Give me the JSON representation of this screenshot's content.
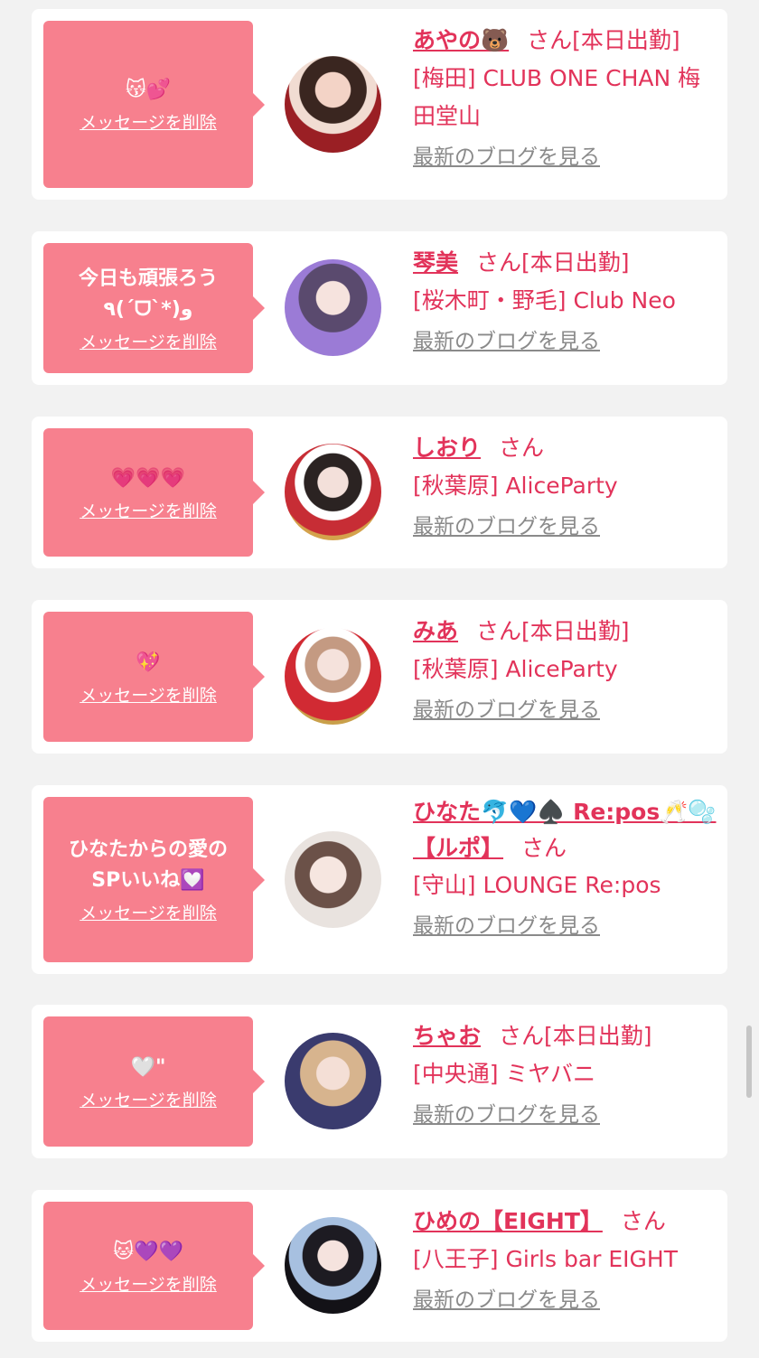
{
  "delete_label": "メッセージを削除",
  "blog_label": "最新のブログを見る",
  "san_label": "さん",
  "accent_color": "#e2335a",
  "bubble_color": "#f7808e",
  "cards": [
    {
      "message": "😽💕",
      "name": "あやの🐻",
      "status": "[本日出勤]",
      "shop": "[梅田] CLUB ONE CHAN 梅田堂山"
    },
    {
      "message": "今日も頑張ろう\n٩(ˊᗜˋ*)و",
      "name": "琴美",
      "status": "[本日出勤]",
      "shop": "[桜木町・野毛] Club Neo"
    },
    {
      "message": "💗💗💗",
      "name": "しおり",
      "status": "",
      "shop": "[秋葉原] AliceParty"
    },
    {
      "message": "💖",
      "name": "みあ",
      "status": "[本日出勤]",
      "shop": "[秋葉原] AliceParty"
    },
    {
      "message": "ひなたからの愛の\nSPいいね💟",
      "name": "ひなた🐬💙♠️ Re:pos🥂🫧【ルポ】",
      "status": "",
      "shop": "[守山] LOUNGE Re:pos"
    },
    {
      "message": "🤍\"",
      "name": "ちゃお",
      "status": "[本日出勤]",
      "shop": "[中央通] ミヤバニ"
    },
    {
      "message": "🐱💜💜",
      "name": "ひめの【EIGHT】",
      "status": "",
      "shop": "[八王子] Girls bar EIGHT"
    }
  ]
}
